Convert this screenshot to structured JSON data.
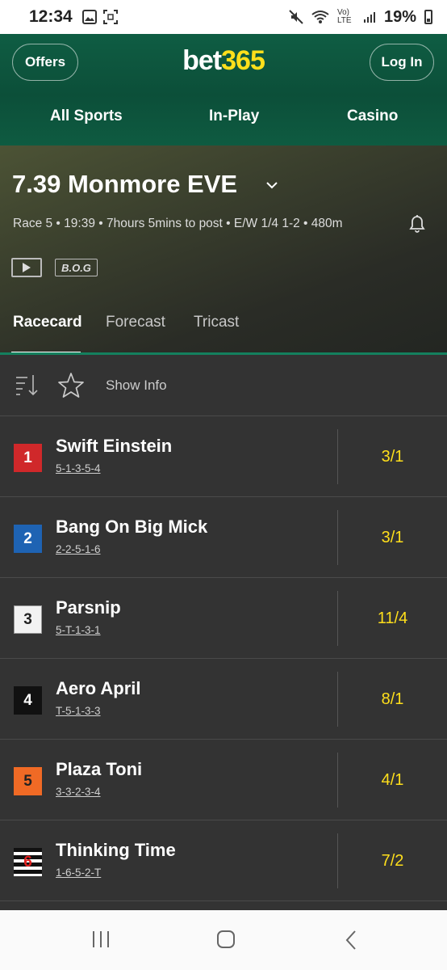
{
  "status_bar": {
    "time": "12:34",
    "battery": "19%",
    "icons": [
      "gallery-icon",
      "screenshot-icon",
      "mute-icon",
      "wifi-icon",
      "lte-icon",
      "signal-icon",
      "battery-icon"
    ],
    "network_label": "Vo) LTE"
  },
  "header": {
    "offers_label": "Offers",
    "login_label": "Log In",
    "logo_white": "bet",
    "logo_yellow": "365",
    "nav": [
      "All Sports",
      "In-Play",
      "Casino"
    ],
    "colors": {
      "brand_green": "#0f5d43",
      "brand_yellow": "#ffdf1b"
    }
  },
  "race": {
    "title": "7.39 Monmore EVE",
    "meta": "Race 5 • 19:39 • 7hours 5mins to post • E/W 1/4 1-2 • 480m",
    "bog_label": "B.O.G",
    "tabs": [
      "Racecard",
      "Forecast",
      "Tricast"
    ],
    "active_tab": "Racecard"
  },
  "toolbar": {
    "show_info_label": "Show Info"
  },
  "runners": [
    {
      "trap": "1",
      "name": "Swift Einstein",
      "form": "5-1-3-5-4",
      "odds": "3/1",
      "trap_color": "#d0282a"
    },
    {
      "trap": "2",
      "name": "Bang On Big Mick",
      "form": "2-2-5-1-6",
      "odds": "3/1",
      "trap_color": "#1e63b3"
    },
    {
      "trap": "3",
      "name": "Parsnip",
      "form": "5-T-1-3-1",
      "odds": "11/4",
      "trap_color": "#f2f2f2"
    },
    {
      "trap": "4",
      "name": "Aero April",
      "form": "T-5-1-3-3",
      "odds": "8/1",
      "trap_color": "#111111"
    },
    {
      "trap": "5",
      "name": "Plaza Toni",
      "form": "3-3-2-3-4",
      "odds": "4/1",
      "trap_color": "#f06a25"
    },
    {
      "trap": "6",
      "name": "Thinking Time",
      "form": "1-6-5-2-T",
      "odds": "7/2",
      "trap_color": "black-white-stripes"
    }
  ]
}
